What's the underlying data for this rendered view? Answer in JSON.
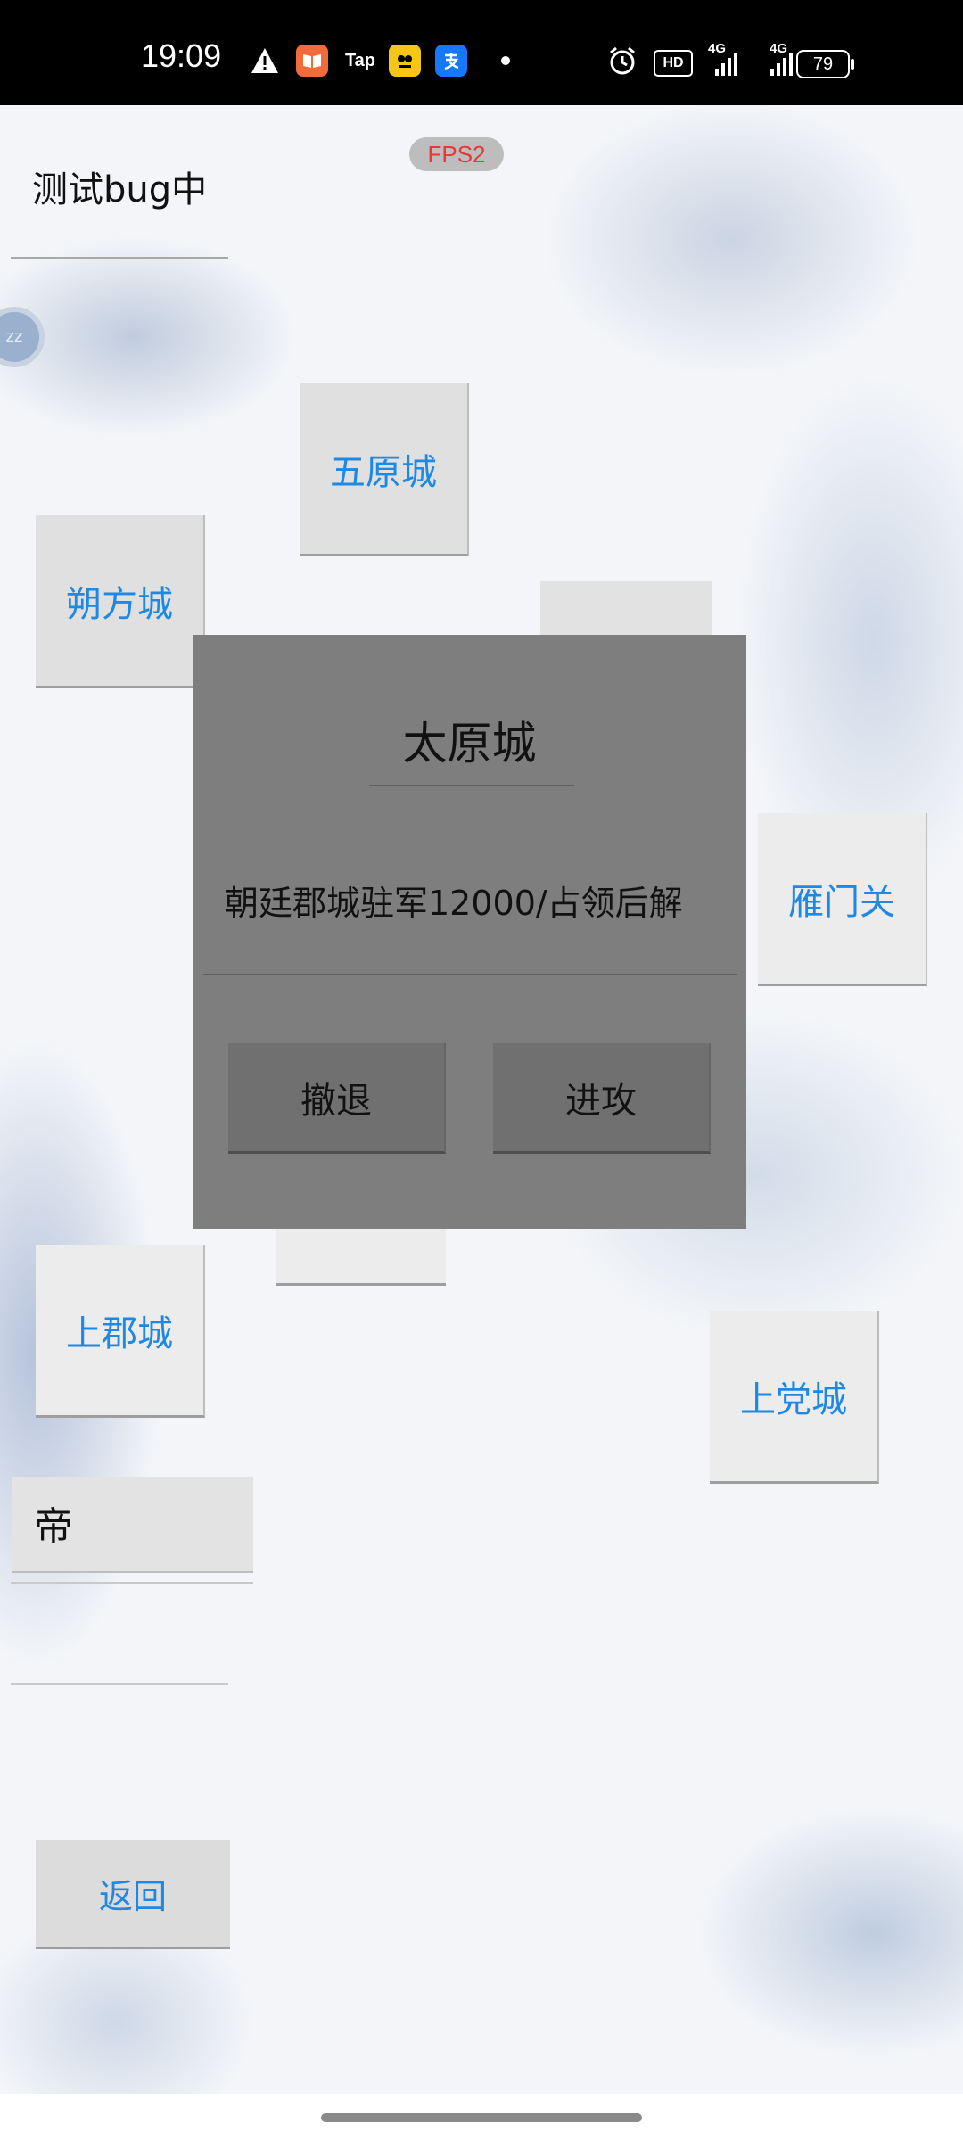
{
  "status_bar": {
    "time": "19:09",
    "app_icons": [
      "warning-icon",
      "books-app-icon",
      "taptap-icon",
      "game-app-icon",
      "alipay-icon"
    ],
    "tap_label": "Tap",
    "hd_label": "HD",
    "net1": "4G",
    "net2": "4G",
    "battery": "79"
  },
  "fps_badge": "FPS2",
  "top_field_text": "测试bug中",
  "cities": {
    "wuyuan": "五原城",
    "shuofang": "朔方城",
    "yanmen": "雁门关",
    "shangjun": "上郡城",
    "shangdang": "上党城"
  },
  "emperor_field": "帝",
  "back_button": "返回",
  "dialog": {
    "title": "太原城",
    "message": "朝廷郡城驻军12000/占领后解",
    "retreat_label": "撤退",
    "attack_label": "进攻"
  },
  "colors": {
    "city_text": "#1e88e5",
    "fps_text": "#e53935",
    "dialog_bg": "#7e7e7e"
  }
}
